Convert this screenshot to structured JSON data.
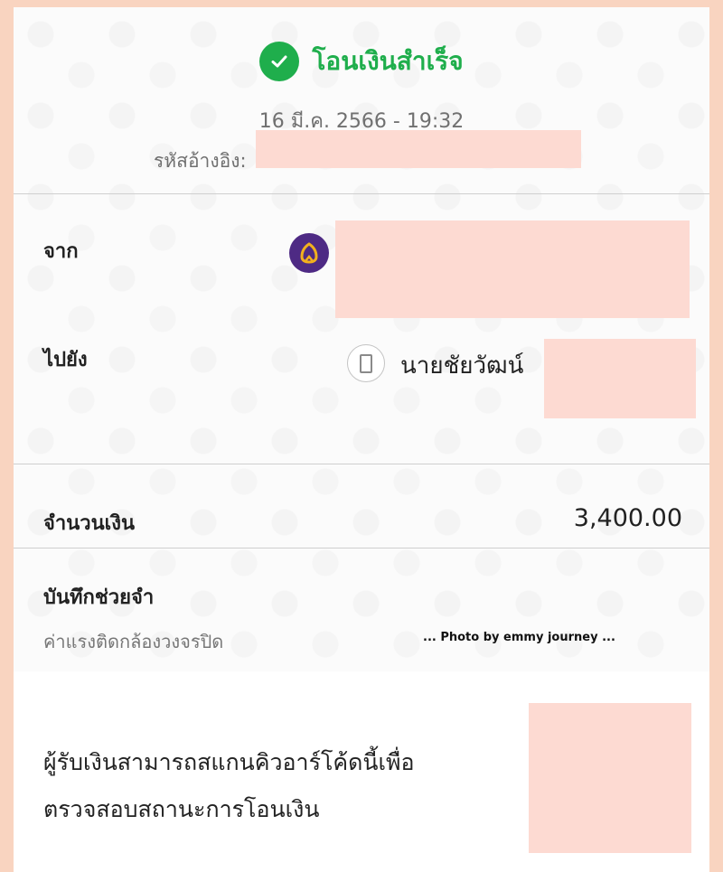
{
  "status": {
    "title": "โอนเงินสำเร็จ",
    "icon": "check-circle-icon",
    "color": "#1fae4c"
  },
  "datetime": "16 มี.ค. 2566 - 19:32",
  "reference": {
    "label": "รหัสอ้างอิง:"
  },
  "from": {
    "label": "จาก",
    "bank_icon": "bank-logo-icon",
    "bank_color": "#4e2a84"
  },
  "to": {
    "label": "ไปยัง",
    "icon": "phone-icon",
    "name": "นายชัยวัฒน์"
  },
  "amount": {
    "label": "จำนวนเงิน",
    "value": "3,400.00"
  },
  "note": {
    "label": "บันทึกช่วยจำ",
    "text": "ค่าแรงติดกล้องวงจรปิด"
  },
  "watermark": "... Photo by emmy journey ...",
  "qr_message": {
    "line1": "ผู้รับเงินสามารถสแกนคิวอาร์โค้ดนี้เพื่อ",
    "line2": "ตรวจสอบสถานะการโอนเงิน"
  }
}
